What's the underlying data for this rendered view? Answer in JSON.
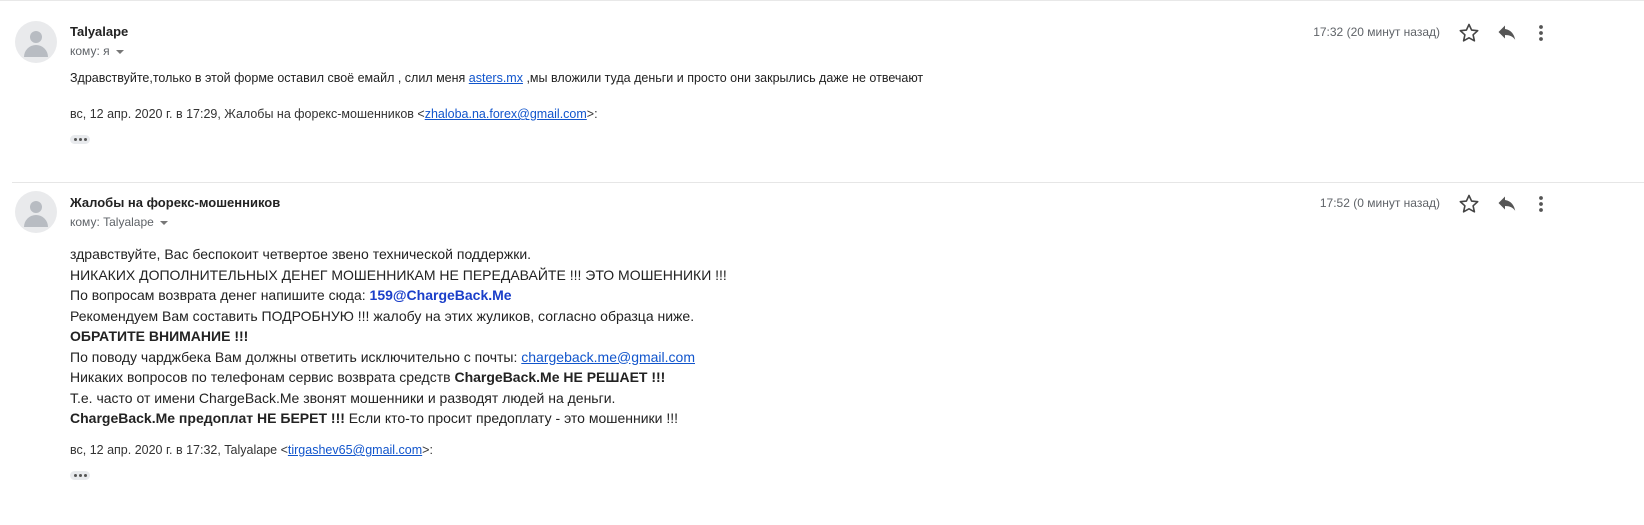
{
  "messages": [
    {
      "sender": "Talyalape",
      "to_label": "кому: я",
      "time": "17:32 (20 минут назад)",
      "body_pre": "Здравствуйте,только в этой форме оставил своё емайл , слил меня ",
      "body_link": "asters.mx",
      "body_post": " ,мы вложили туда деньги и просто они закрылись даже не отвечают",
      "quote_pre": "вс, 12 апр. 2020 г. в 17:29, Жалобы на форекс-мошенников <",
      "quote_email": "zhaloba.na.forex@gmail.com",
      "quote_post": ">:"
    },
    {
      "sender": "Жалобы на форекс-мошенников",
      "to_label": "кому: Talyalape",
      "time": "17:52 (0 минут назад)",
      "lines": {
        "l1": "здравствуйте, Вас беспокоит четвертое звено технической поддержки.",
        "l2": "НИКАКИХ ДОПОЛНИТЕЛЬНЫХ ДЕНЕГ МОШЕННИКАМ НЕ ПЕРЕДАВАЙТЕ !!! ЭТО МОШЕННИКИ !!!",
        "l3_pre": "По вопросам возврата денег напишите сюда: ",
        "l3_email": "159@ChargeBack.Me",
        "l4": "Рекомендуем Вам составить ПОДРОБНУЮ !!! жалобу на этих жуликов, согласно образца ниже.",
        "l5": "ОБРАТИТЕ ВНИМАНИЕ !!!",
        "l6_pre": "По поводу чарджбека Вам должны ответить исключительно с почты: ",
        "l6_email": "chargeback.me@gmail.com",
        "l7_pre": "Никаких вопросов по телефонам сервис возврата средств ",
        "l7_bold": "ChargeBack.Me НЕ РЕШАЕТ !!!",
        "l8": "Т.е. часто от имени ChargeBack.Me звонят мошенники и разводят людей на деньги.",
        "l9_bold": "ChargeBack.Me предоплат НЕ БЕРЕТ !!!",
        "l9_post": " Если кто-то просит предоплату - это мошенники !!!"
      },
      "quote_pre": "вс, 12 апр. 2020 г. в 17:32, Talyalape <",
      "quote_email": "tirgashev65@gmail.com",
      "quote_post": ">:"
    }
  ],
  "icons": {
    "avatar": "person-icon",
    "star": "star-icon",
    "reply": "reply-icon",
    "more": "more-vertical-icon",
    "dropdown": "chevron-down-icon",
    "expand": "ellipsis-icon"
  },
  "colors": {
    "link": "#1155cc",
    "email_blue": "#1a3ec9",
    "meta_text": "#5f6368"
  }
}
